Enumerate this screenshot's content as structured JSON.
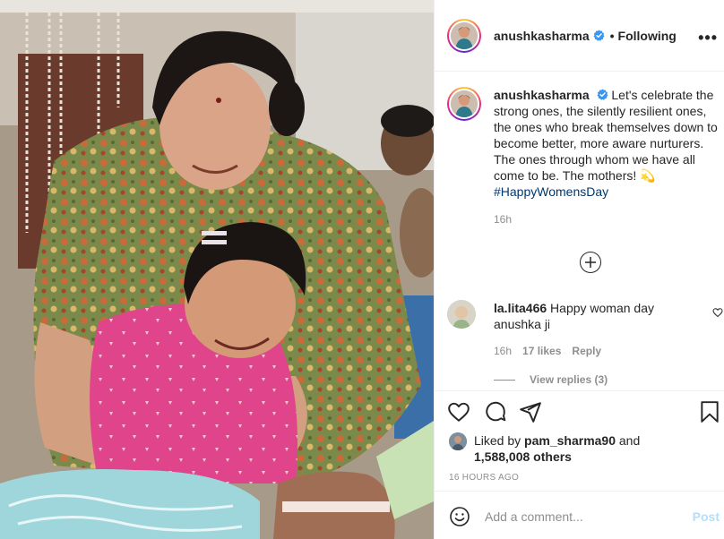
{
  "post": {
    "author": "anushkasharma",
    "follow_separator": "•",
    "follow_status": "Following",
    "more_label": "•••",
    "caption": {
      "username": "anushkasharma",
      "text": "Let's celebrate the strong ones, the silently resilient ones, the ones who break themselves down to become better, more aware nurturers. The ones through whom we have all come to be. The mothers!",
      "emoji": "💫",
      "hashtag": "#HappyWomensDay",
      "time": "16h"
    },
    "load_more_icon": "plus-circle-icon",
    "comments": [
      {
        "username": "la.lita466",
        "text": "Happy woman day anushka ji",
        "time": "16h",
        "likes": "17 likes",
        "reply_label": "Reply",
        "view_replies": "View replies (3)"
      }
    ],
    "liked_by_prefix": "Liked by",
    "liked_by_user": "pam_sharma90",
    "liked_by_and": "and",
    "liked_by_others": "1,588,008 others",
    "timestamp": "16 HOURS AGO",
    "add_comment_placeholder": "Add a comment...",
    "post_button": "Post"
  },
  "colors": {
    "verified": "#3897f0",
    "hashtag": "#00376b",
    "post_button_disabled": "#b2dffc",
    "secondary_text": "#8e8e8e"
  }
}
